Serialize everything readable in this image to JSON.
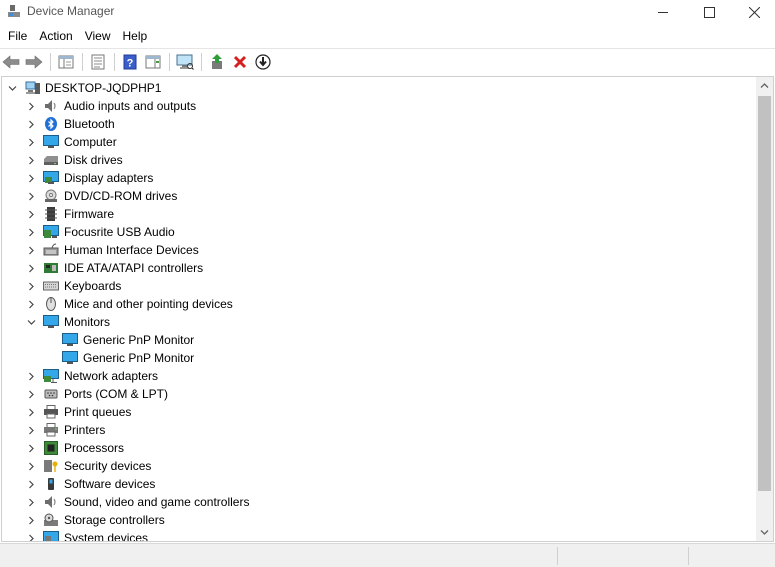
{
  "window": {
    "title": "Device Manager"
  },
  "menu": [
    "File",
    "Action",
    "View",
    "Help"
  ],
  "toolbar": {
    "buttons": [
      {
        "name": "back-button",
        "icon": "arrow-left-icon"
      },
      {
        "name": "forward-button",
        "icon": "arrow-right-icon"
      },
      {
        "name": "show-hide-console-tree-button",
        "icon": "console-tree-icon"
      },
      {
        "name": "properties-button",
        "icon": "properties-icon"
      },
      {
        "name": "help-button",
        "icon": "help-icon"
      },
      {
        "name": "show-action-pane-button",
        "icon": "action-pane-icon"
      },
      {
        "name": "scan-hardware-changes-button",
        "icon": "monitor-scan-icon"
      },
      {
        "name": "update-driver-button",
        "icon": "update-driver-icon"
      },
      {
        "name": "uninstall-device-button",
        "icon": "red-x-icon"
      },
      {
        "name": "disable-device-button",
        "icon": "down-arrow-circle-icon"
      }
    ]
  },
  "tree": {
    "root": {
      "label": "DESKTOP-JQDPHP1",
      "icon": "computer-icon",
      "expanded": true
    },
    "categories": [
      {
        "label": "Audio inputs and outputs",
        "icon": "speaker-icon",
        "expanded": false
      },
      {
        "label": "Bluetooth",
        "icon": "bluetooth-icon",
        "expanded": false
      },
      {
        "label": "Computer",
        "icon": "monitor-icon",
        "expanded": false
      },
      {
        "label": "Disk drives",
        "icon": "disk-drive-icon",
        "expanded": false
      },
      {
        "label": "Display adapters",
        "icon": "display-adapter-icon",
        "expanded": false
      },
      {
        "label": "DVD/CD-ROM drives",
        "icon": "dvd-icon",
        "expanded": false
      },
      {
        "label": "Firmware",
        "icon": "firmware-chip-icon",
        "expanded": false
      },
      {
        "label": "Focusrite USB Audio",
        "icon": "usb-audio-icon",
        "expanded": false
      },
      {
        "label": "Human Interface Devices",
        "icon": "hid-icon",
        "expanded": false
      },
      {
        "label": "IDE ATA/ATAPI controllers",
        "icon": "ide-controller-icon",
        "expanded": false
      },
      {
        "label": "Keyboards",
        "icon": "keyboard-icon",
        "expanded": false
      },
      {
        "label": "Mice and other pointing devices",
        "icon": "mouse-icon",
        "expanded": false
      },
      {
        "label": "Monitors",
        "icon": "monitor-icon",
        "expanded": true,
        "children": [
          "Generic PnP Monitor",
          "Generic PnP Monitor"
        ]
      },
      {
        "label": "Network adapters",
        "icon": "network-adapter-icon",
        "expanded": false
      },
      {
        "label": "Ports (COM & LPT)",
        "icon": "port-icon",
        "expanded": false
      },
      {
        "label": "Print queues",
        "icon": "print-queue-icon",
        "expanded": false
      },
      {
        "label": "Printers",
        "icon": "printer-icon",
        "expanded": false
      },
      {
        "label": "Processors",
        "icon": "processor-icon",
        "expanded": false
      },
      {
        "label": "Security devices",
        "icon": "security-key-icon",
        "expanded": false
      },
      {
        "label": "Software devices",
        "icon": "software-device-icon",
        "expanded": false
      },
      {
        "label": "Sound, video and game controllers",
        "icon": "speaker-icon",
        "expanded": false
      },
      {
        "label": "Storage controllers",
        "icon": "storage-controller-icon",
        "expanded": false
      },
      {
        "label": "System devices",
        "icon": "system-devices-icon",
        "expanded": false
      }
    ]
  },
  "colors": {
    "accent_blue": "#1e90d6",
    "monitor_blue": "#33a7e8",
    "uninstall_red": "#d42020",
    "update_green": "#2f9e3a"
  }
}
